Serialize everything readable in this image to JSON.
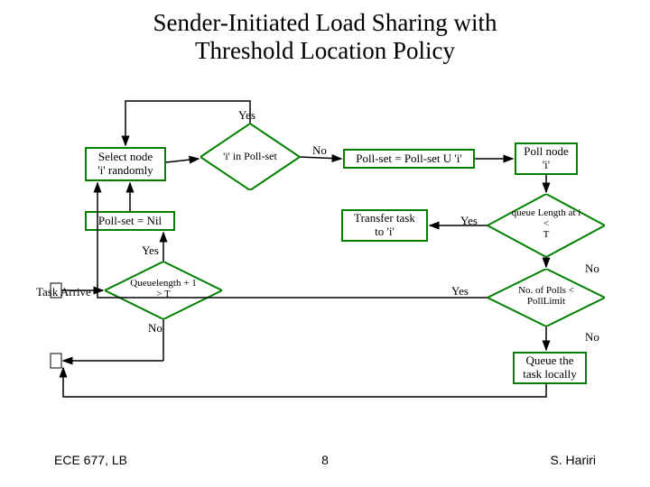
{
  "title_line1": "Sender-Initiated Load Sharing with",
  "title_line2": "Threshold Location Policy",
  "nodes": {
    "select_node": "Select node\n'i' randomly",
    "i_in_pollset": "'i' in Poll-set",
    "pollset_union": "Poll-set = Poll-set U 'i'",
    "poll_node": "Poll node\n'i'",
    "pollset_nil": "Poll-set = Nil",
    "transfer_task": "Transfer task\nto 'i'",
    "queue_len_lt_t": "queue Length at i\n<\nT",
    "queuelength_gt_t": "Queuelength + 1\n> T",
    "task_arrive": "Task Arrive",
    "polls_lt_limit": "No. of Polls <\nPollLimit",
    "queue_locally": "Queue the\ntask locally"
  },
  "labels": {
    "yes_top": "Yes",
    "no_mid": "No",
    "yes_pollset": "Yes",
    "yes_transfer": "Yes",
    "yes_qlen": "Yes",
    "no_qlen_gt": "No",
    "no_queue_lt": "No",
    "no_polls": "No"
  },
  "footer": {
    "left": "ECE 677, LB",
    "center": "8",
    "right": "S. Hariri"
  }
}
